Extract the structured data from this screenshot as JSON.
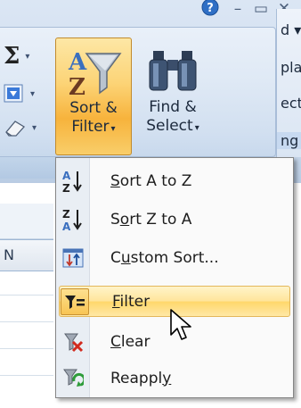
{
  "window_buttons": {
    "help_icon": "help-icon",
    "minimize_glyph": "–",
    "restore_glyph": "▭",
    "close_glyph": "✕"
  },
  "editing_group": {
    "sigma_glyph": "Σ",
    "dropdown_glyph": "▾",
    "sort_filter": {
      "line1": "Sort &",
      "line2": "Filter"
    },
    "find_select": {
      "line1": "Find &",
      "line2": "Select"
    }
  },
  "right_strip": {
    "lines": [
      "d ▾",
      "plac",
      "ect",
      "ng"
    ]
  },
  "sheet": {
    "column_header": "N"
  },
  "menu": {
    "items": [
      {
        "pre": "",
        "accel": "S",
        "post": "ort A to Z",
        "icon": "sort-a-to-z-icon"
      },
      {
        "pre": "S",
        "accel": "o",
        "post": "rt Z to A",
        "icon": "sort-z-to-a-icon"
      },
      {
        "pre": "C",
        "accel": "u",
        "post": "stom Sort...",
        "icon": "custom-sort-icon"
      },
      {
        "pre": "",
        "accel": "F",
        "post": "ilter",
        "icon": "filter-icon"
      },
      {
        "pre": "",
        "accel": "C",
        "post": "lear",
        "icon": "clear-filter-icon"
      },
      {
        "pre": "Reappl",
        "accel": "y",
        "post": "",
        "icon": "reapply-icon"
      }
    ]
  },
  "colors": {
    "ribbon_bg": "#d7e3f2",
    "hover_orange": "#ffd76a",
    "menu_border": "#868686"
  }
}
